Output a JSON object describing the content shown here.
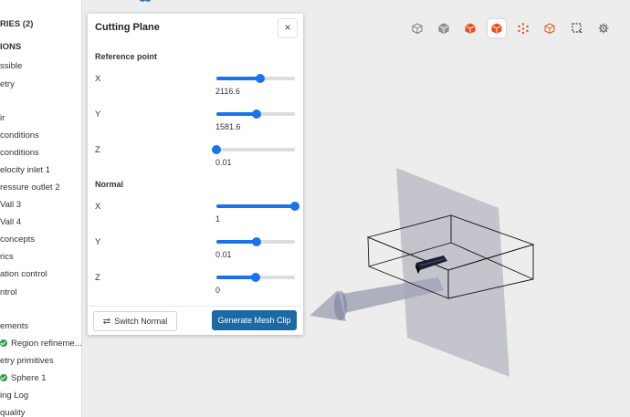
{
  "sidebar": {
    "items": [
      {
        "label": "RIES (2)",
        "bold": true
      },
      {
        "label": "IONS",
        "bold": true
      },
      {
        "label": "ssible",
        "bold": false
      },
      {
        "label": "etry",
        "bold": false
      },
      {
        "label": "ir",
        "bold": false
      },
      {
        "label": " conditions",
        "bold": false
      },
      {
        "label": " conditions",
        "bold": false
      },
      {
        "label": "elocity inlet 1",
        "bold": false
      },
      {
        "label": "ressure outlet 2",
        "bold": false
      },
      {
        "label": "Vall 3",
        "bold": false
      },
      {
        "label": "Vall 4",
        "bold": false
      },
      {
        "label": " concepts",
        "bold": false
      },
      {
        "label": "rics",
        "bold": false
      },
      {
        "label": "ation control",
        "bold": false
      },
      {
        "label": "ntrol",
        "bold": false
      },
      {
        "label": "ements",
        "bold": false
      },
      {
        "label": "Region refineme...",
        "bold": false,
        "check": true
      },
      {
        "label": "etry primitives",
        "bold": false
      },
      {
        "label": "Sphere 1",
        "bold": false,
        "check": true
      },
      {
        "label": "ing Log",
        "bold": false
      },
      {
        "label": "quality",
        "bold": false
      }
    ]
  },
  "panel": {
    "title": "Cutting Plane",
    "close": "×",
    "reference_label": "Reference point",
    "normal_label": "Normal",
    "reference": [
      {
        "axis": "X",
        "value": "2116.6",
        "fraction": 0.56
      },
      {
        "axis": "Y",
        "value": "1581.6",
        "fraction": 0.51
      },
      {
        "axis": "Z",
        "value": "0.01",
        "fraction": 0.0
      }
    ],
    "normal": [
      {
        "axis": "X",
        "value": "1",
        "fraction": 1.0
      },
      {
        "axis": "Y",
        "value": "0.01",
        "fraction": 0.51
      },
      {
        "axis": "Z",
        "value": "0",
        "fraction": 0.5
      }
    ],
    "switch_label": "Switch Normal",
    "generate_label": "Generate Mesh Clip"
  },
  "toolbar": {
    "buttons": [
      {
        "icon": "cube-outline-icon",
        "color": "#777777"
      },
      {
        "icon": "cube-solid-icon",
        "color": "#777777"
      },
      {
        "icon": "cube-faces-icon",
        "color": "#e0531f"
      },
      {
        "icon": "cube-edges-icon",
        "color": "#e0531f",
        "active": true
      },
      {
        "icon": "cube-vertices-icon",
        "color": "#e0531f"
      },
      {
        "icon": "cube-volume-icon",
        "color": "#e0531f"
      },
      {
        "icon": "box-select-icon",
        "color": "#444444"
      },
      {
        "icon": "settings-cube-icon",
        "color": "#555555"
      }
    ]
  },
  "colors": {
    "accent": "#1a73e8",
    "primary_button": "#1b6aa5",
    "check": "#2e9e4a"
  }
}
